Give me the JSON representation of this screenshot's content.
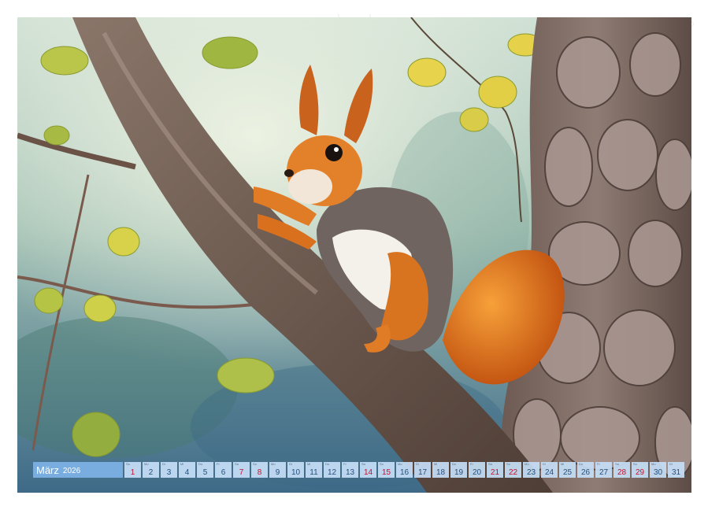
{
  "calendar": {
    "month": "März",
    "year": "2026",
    "days": [
      {
        "day": "1",
        "wd": "So",
        "type": "sun"
      },
      {
        "day": "2",
        "wd": "Mo",
        "type": ""
      },
      {
        "day": "3",
        "wd": "Di",
        "type": ""
      },
      {
        "day": "4",
        "wd": "Mi",
        "type": ""
      },
      {
        "day": "5",
        "wd": "Do",
        "type": ""
      },
      {
        "day": "6",
        "wd": "Fr",
        "type": ""
      },
      {
        "day": "7",
        "wd": "Sa",
        "type": "sun"
      },
      {
        "day": "8",
        "wd": "So",
        "type": "sun"
      },
      {
        "day": "9",
        "wd": "Mo",
        "type": ""
      },
      {
        "day": "10",
        "wd": "Di",
        "type": ""
      },
      {
        "day": "11",
        "wd": "Mi",
        "type": ""
      },
      {
        "day": "12",
        "wd": "Do",
        "type": ""
      },
      {
        "day": "13",
        "wd": "Fr",
        "type": ""
      },
      {
        "day": "14",
        "wd": "Sa",
        "type": "sun"
      },
      {
        "day": "15",
        "wd": "So",
        "type": "sun"
      },
      {
        "day": "16",
        "wd": "Mo",
        "type": ""
      },
      {
        "day": "17",
        "wd": "Di",
        "type": ""
      },
      {
        "day": "18",
        "wd": "Mi",
        "type": ""
      },
      {
        "day": "19",
        "wd": "Do",
        "type": ""
      },
      {
        "day": "20",
        "wd": "Fr",
        "type": ""
      },
      {
        "day": "21",
        "wd": "Sa",
        "type": "sun"
      },
      {
        "day": "22",
        "wd": "So",
        "type": "sun"
      },
      {
        "day": "23",
        "wd": "Mo",
        "type": ""
      },
      {
        "day": "24",
        "wd": "Di",
        "type": ""
      },
      {
        "day": "25",
        "wd": "Mi",
        "type": ""
      },
      {
        "day": "26",
        "wd": "Do",
        "type": ""
      },
      {
        "day": "27",
        "wd": "Fr",
        "type": ""
      },
      {
        "day": "28",
        "wd": "Sa",
        "type": "sun"
      },
      {
        "day": "29",
        "wd": "So",
        "type": "sun"
      },
      {
        "day": "30",
        "wd": "Mo",
        "type": ""
      },
      {
        "day": "31",
        "wd": "Di",
        "type": ""
      }
    ]
  },
  "colors": {
    "month_bar": "#7fb2e6",
    "day_cell": "#c6def6",
    "weekday_text": "#28507a",
    "weekend_text": "#c8102e"
  }
}
